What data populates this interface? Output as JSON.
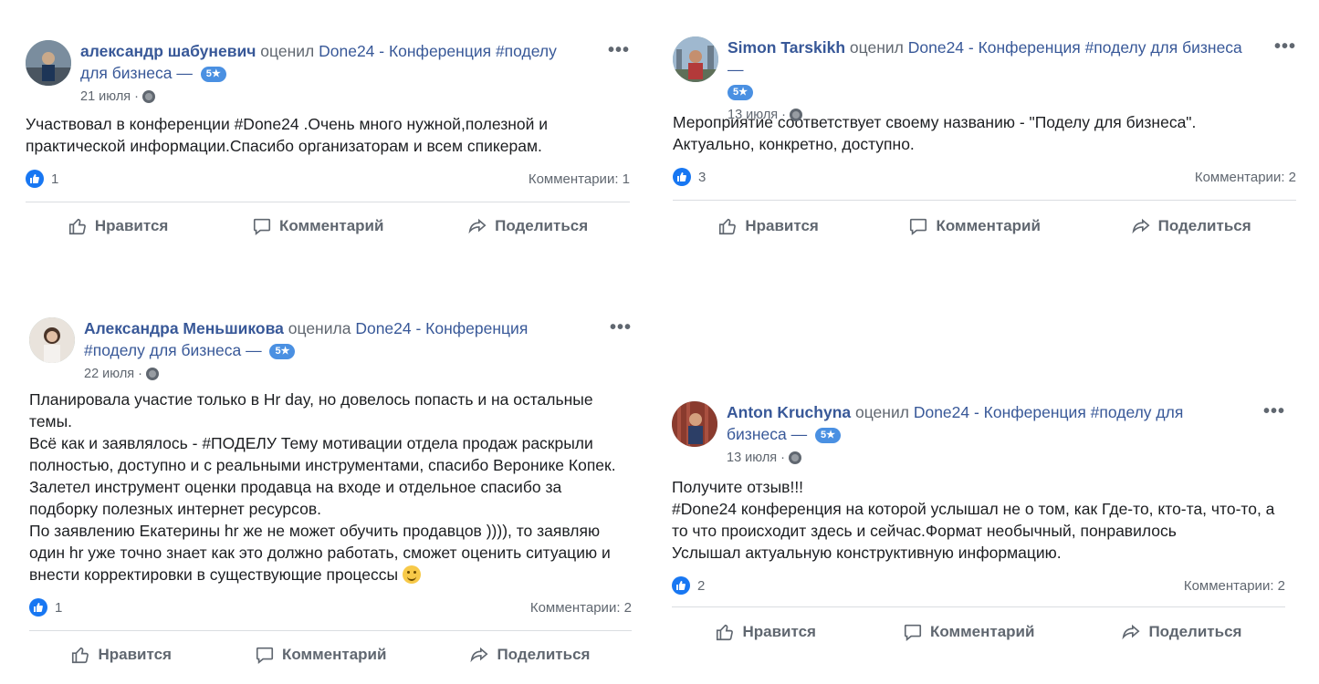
{
  "common": {
    "badge": "5★",
    "dash": "—",
    "more": "•••",
    "like_label": "Нравится",
    "comment_label": "Комментарий",
    "share_label": "Поделиться"
  },
  "posts": [
    {
      "author": "александр шабуневич",
      "verb": "оценил",
      "page": "Done24 - Конференция #поделу для бизнеса",
      "date": "21 июля ·",
      "text": "Участвовал в конференции #Done24 .Очень много нужной,полезной и практической информации.Спасибо организаторам и всем спикерам.",
      "likes": "1",
      "comments": "Комментарии: 1"
    },
    {
      "author": "Simon Tarskikh",
      "verb": "оценил",
      "page": "Done24 - Конференция #поделу для бизнеса",
      "date": "13 июля ·",
      "text": "Мероприятие соответствует своему названию - \"Поделу для бизнеса\".\nАктуально, конкретно, доступно.",
      "likes": "3",
      "comments": "Комментарии: 2"
    },
    {
      "author": "Александра Меньшикова",
      "verb": "оценила",
      "page": "Done24 - Конференция #поделу для бизнеса",
      "date": "22 июля ·",
      "text": "Планировала участие только в Hr day, но довелось попасть и на остальные темы.\nВсё как и заявлялось - #ПОДЕЛУ Тему мотивации отдела продаж раскрыли полностью, доступно и с реальными инструментами, спасибо Веронике Копек.\nЗалетел инструмент оценки продавца на входе и отдельное спасибо за подборку полезных интернет ресурсов.\nПо заявлению Екатерины hr же не может обучить продавцов )))), то заявляю один hr уже точно знает как это должно работать, сможет оценить ситуацию и внести корректировки в существующие процессы",
      "likes": "1",
      "comments": "Комментарии: 2"
    },
    {
      "author": "Anton Kruchyna",
      "verb": "оценил",
      "page": "Done24 - Конференция #поделу для бизнеса",
      "date": "13 июля ·",
      "text": "Получите отзыв!!!\n#Done24 конференция на которой услышал не о том, как Где-то, кто-та, что-то, а то что происходит здесь и сейчас.Формат необычный, понравилось\nУслышал актуальную конструктивную информацию.",
      "likes": "2",
      "comments": "Комментарии: 2"
    }
  ]
}
